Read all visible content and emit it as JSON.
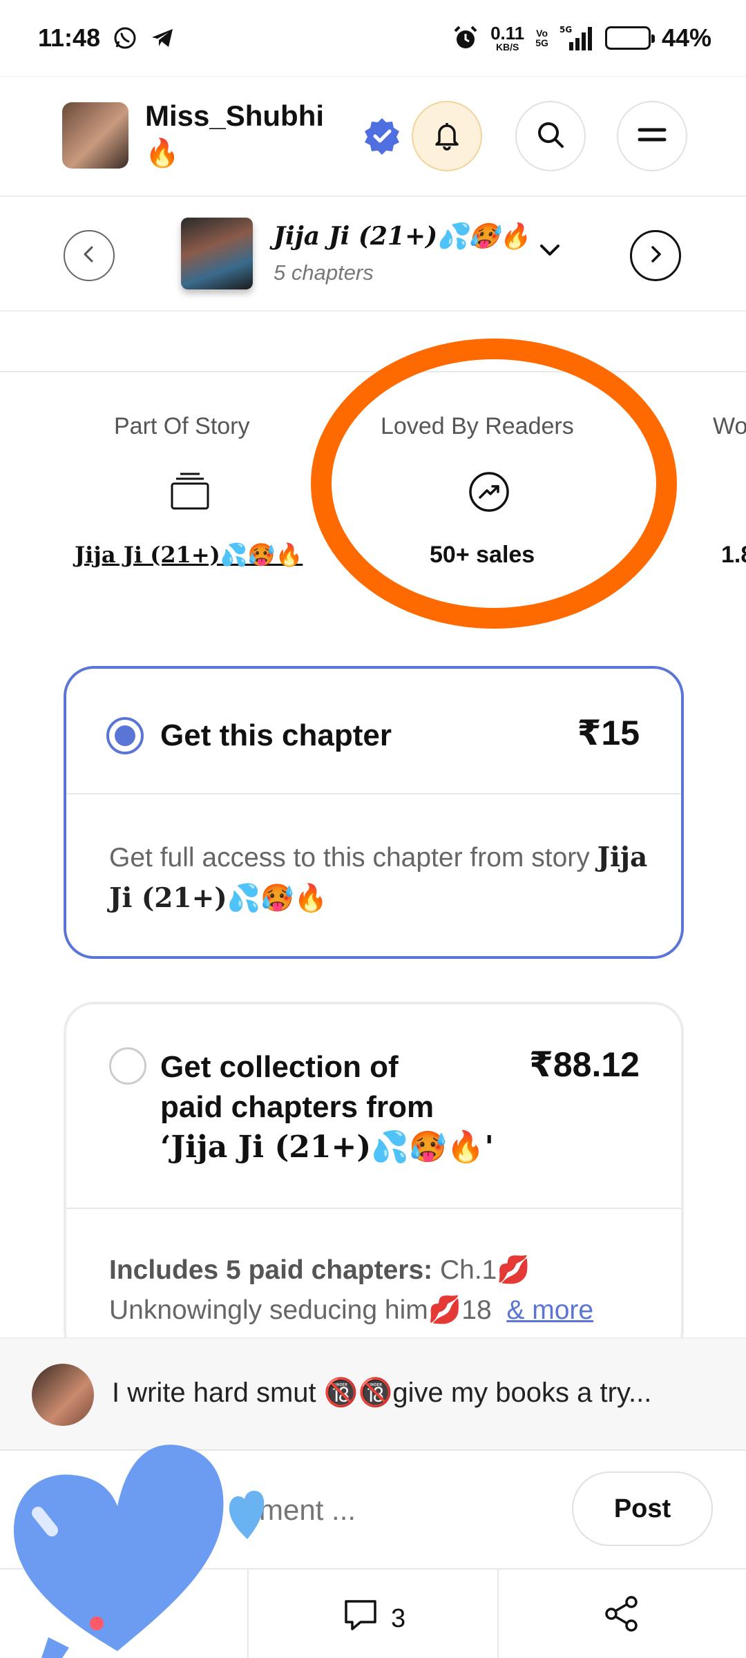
{
  "status_bar": {
    "time": "11:48",
    "net_speed_value": "0.11",
    "net_speed_unit": "KB/S",
    "volte_label_top": "Vo",
    "volte_label_bottom": "5G",
    "network": "5G",
    "battery": "44%",
    "battery_level": 0.44
  },
  "header": {
    "author_name": "Miss_Shubhi",
    "author_emoji": "🔥"
  },
  "story": {
    "title": "Jija Ji (21+)💦🥵🔥",
    "chapters": "5 chapters"
  },
  "stats": [
    {
      "label": "Part Of Story",
      "value": "Jija Ji (21+)💦🥵🔥"
    },
    {
      "label": "Loved By Readers",
      "value": "50+ sales"
    },
    {
      "label": "Wo",
      "value": "1.8"
    }
  ],
  "options": {
    "chapter": {
      "title": "Get this chapter",
      "price": "₹15",
      "desc_prefix": "Get full access to this chapter from story ",
      "desc_story": "Jija Ji (21+)💦🥵🔥"
    },
    "collection": {
      "title_line1": "Get collection of",
      "title_line2": "paid chapters from",
      "title_line3": "‘Jija Ji (21+)💦🥵🔥'",
      "price": "₹88.12",
      "includes_label": "Includes 5 paid chapters:",
      "includes_text_1": " Ch.1💋",
      "includes_text_2": "Unknowingly seducing him💋18",
      "more_link": "& more"
    }
  },
  "comment": {
    "text": "I write hard smut 🔞🔞give my books a try...",
    "input_placeholder": "mment ...",
    "post_label": "Post"
  },
  "bottom_bar": {
    "comment_count": "3"
  },
  "colors": {
    "accent": "#5b75d6",
    "highlight_ring": "#ff6a00",
    "battery_fill": "#f2b600",
    "overlay_heart": "#6b9cf2"
  }
}
